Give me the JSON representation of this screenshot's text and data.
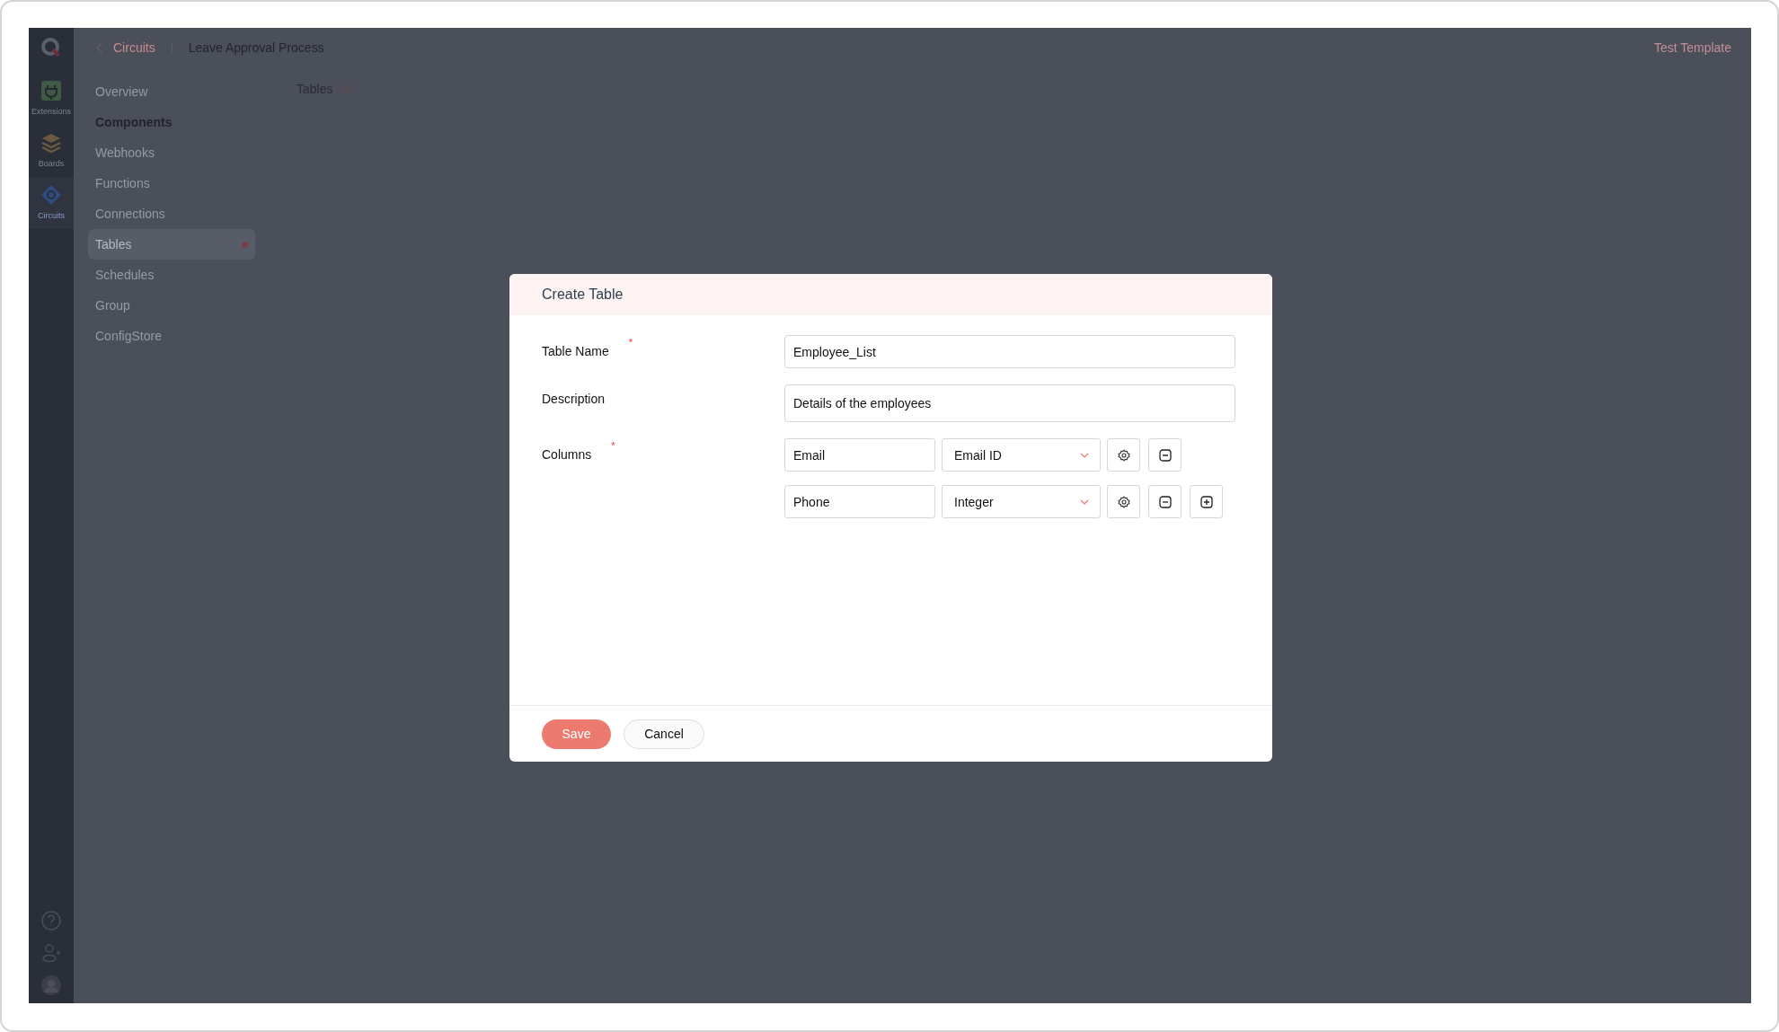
{
  "breadcrumb": {
    "back": "Circuits",
    "current": "Leave Approval Process"
  },
  "header_right": "Test Template",
  "rail": [
    {
      "kind": "extensions",
      "label": "Extensions",
      "selected": false
    },
    {
      "kind": "boards",
      "label": "Boards",
      "selected": false
    },
    {
      "kind": "circuits",
      "label": "Circuits",
      "selected": true
    }
  ],
  "rail_bottom": [
    {
      "kind": "help"
    },
    {
      "kind": "add-user"
    },
    {
      "kind": "avatar"
    }
  ],
  "nav": [
    {
      "label": "Overview",
      "kind": "item",
      "selected": false,
      "dot": false
    },
    {
      "label": "Components",
      "kind": "section",
      "selected": false,
      "dot": false
    },
    {
      "label": "Webhooks",
      "kind": "item",
      "selected": false,
      "dot": false
    },
    {
      "label": "Functions",
      "kind": "item",
      "selected": false,
      "dot": false
    },
    {
      "label": "Connections",
      "kind": "item",
      "selected": false,
      "dot": false
    },
    {
      "label": "Tables",
      "kind": "item",
      "selected": true,
      "dot": true
    },
    {
      "label": "Schedules",
      "kind": "item",
      "selected": false,
      "dot": false
    },
    {
      "label": "Group",
      "kind": "item",
      "selected": false,
      "dot": false
    },
    {
      "label": "ConfigStore",
      "kind": "item",
      "selected": false,
      "dot": false
    }
  ],
  "page_title": "Tables",
  "dialog": {
    "title": "Create Table",
    "fields": [
      {
        "label": "Table Name",
        "required_mark": "*",
        "value": "Employee_List"
      },
      {
        "label": "Description",
        "value": "Details of the employees"
      }
    ],
    "columns_label": "Columns",
    "columns_required_mark": "*",
    "columns": [
      {
        "name": "Email",
        "type": "Email ID",
        "add_button": false
      },
      {
        "name": "Phone",
        "type": "Integer",
        "add_button": true
      }
    ],
    "buttons": [
      {
        "label": "Save",
        "kind": "primary"
      },
      {
        "label": "Cancel",
        "kind": "secondary"
      }
    ]
  }
}
